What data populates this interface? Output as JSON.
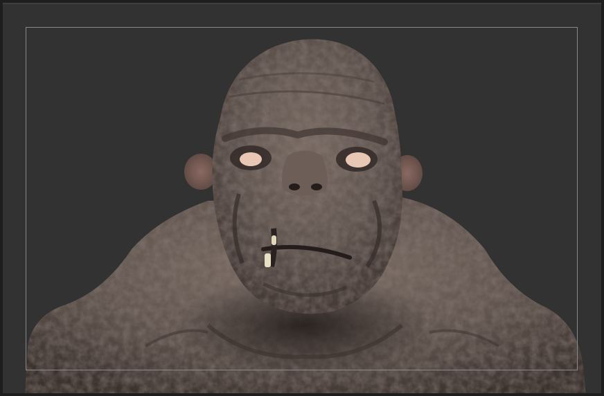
{
  "viewport": {
    "background_color": "#323232",
    "frame_color": "#8a8a8a",
    "model": {
      "skin_base_color": "#6b5e57",
      "skin_shadow_color": "#3a302c",
      "skin_highlight_color": "#8c7d73",
      "eye_color": "#e8c8b4",
      "tooth_color": "#e9dfc6"
    }
  }
}
